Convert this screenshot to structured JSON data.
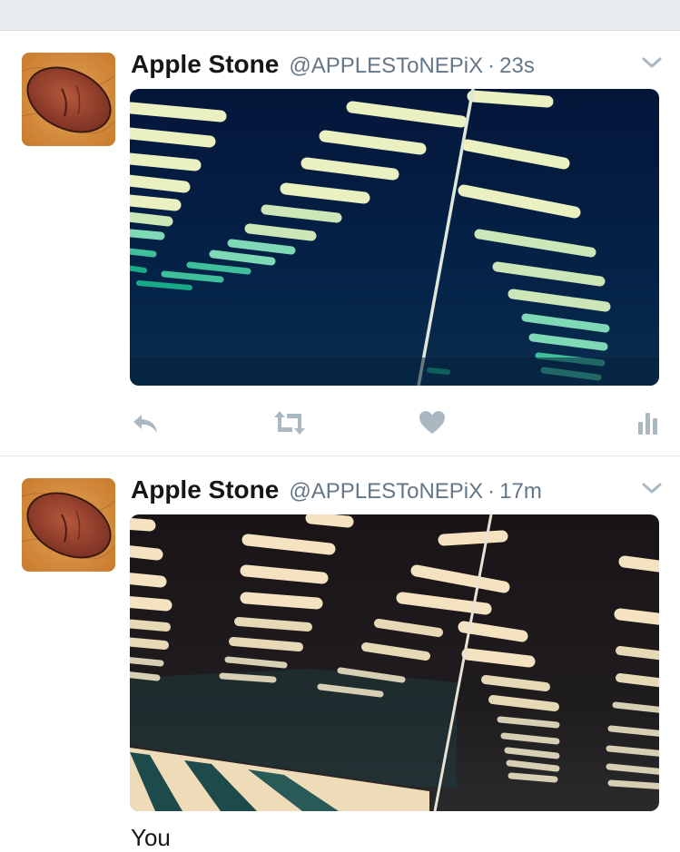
{
  "colors": {
    "name": "#14171a",
    "meta": "#657786",
    "icon": "#aab8c2",
    "band": "#e6ecf0",
    "divider": "#e1e8ed"
  },
  "tweets": [
    {
      "author_name": "Apple Stone",
      "author_handle": "@APPLESToNEPiX",
      "separator": "·",
      "time": "23s",
      "icons": [
        "reply-icon",
        "retweet-icon",
        "like-icon",
        "analytics-icon"
      ]
    },
    {
      "author_name": "Apple Stone",
      "author_handle": "@APPLESToNEPiX",
      "separator": "·",
      "time": "17m",
      "text_preview": "You"
    }
  ]
}
